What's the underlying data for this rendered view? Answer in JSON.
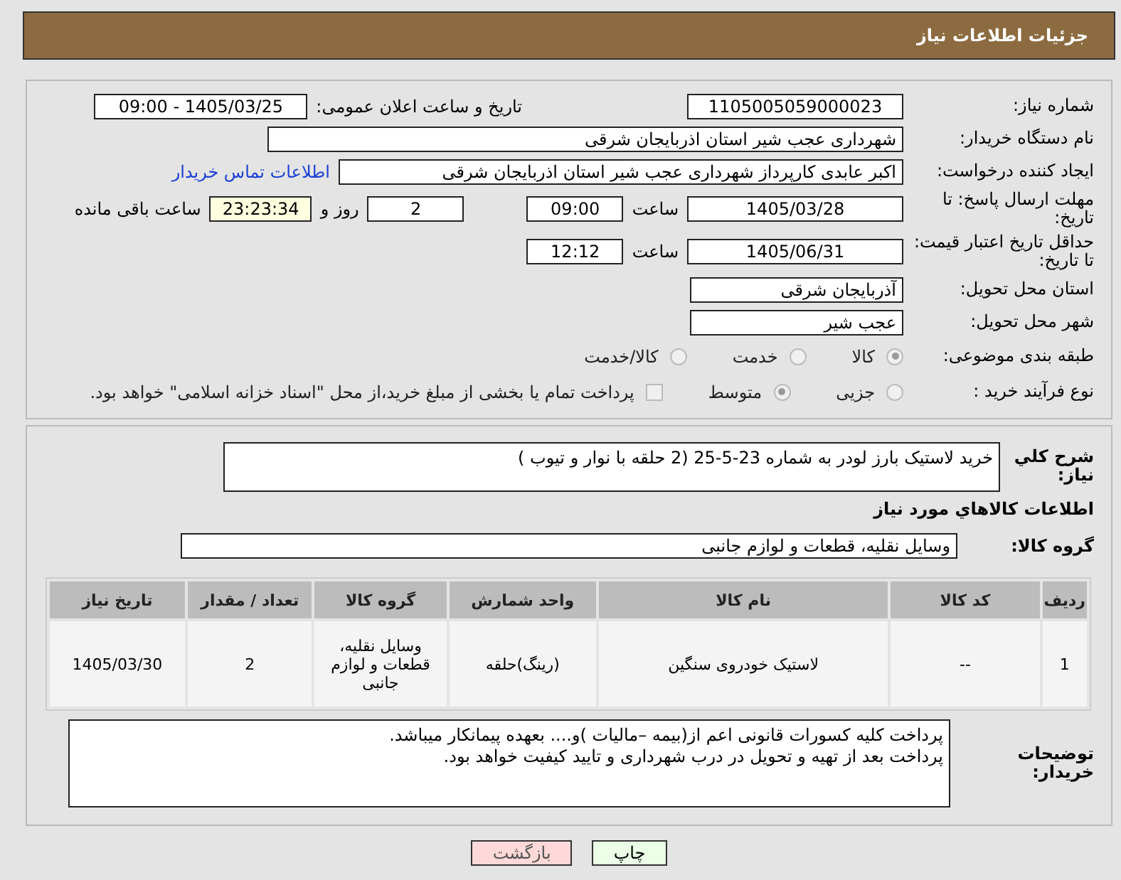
{
  "header": {
    "title": "جزئیات اطلاعات نیاز"
  },
  "need_number": {
    "label": "شماره نیاز:",
    "value": "1105005059000023"
  },
  "announce": {
    "label": "تاریخ و ساعت اعلان عمومی:",
    "value": "1405/03/25 - 09:00"
  },
  "buyer_org": {
    "label": "نام دستگاه خریدار:",
    "value": "شهرداری عجب شیر استان اذربایجان شرقی"
  },
  "requester": {
    "label": "ایجاد کننده درخواست:",
    "value": "اکبر عابدی کارپرداز شهرداری عجب شیر استان اذربایجان شرقی",
    "link": "اطلاعات تماس خریدار"
  },
  "deadline": {
    "label": "مهلت ارسال پاسخ: تا تاریخ:",
    "date": "1405/03/28",
    "time_label": "ساعت",
    "time": "09:00",
    "days": "2",
    "days_label": "روز و",
    "remaining": "23:23:34",
    "remaining_label": "ساعت باقی مانده"
  },
  "validity": {
    "label": "حداقل تاریخ اعتبار قیمت: تا تاریخ:",
    "date": "1405/06/31",
    "time_label": "ساعت",
    "time": "12:12"
  },
  "province": {
    "label": "استان محل تحویل:",
    "value": "آذربایجان شرقی"
  },
  "city": {
    "label": "شهر محل تحویل:",
    "value": "عجب شیر"
  },
  "category": {
    "label": "طبقه بندی موضوعی:",
    "options": [
      {
        "label": "کالا",
        "selected": true
      },
      {
        "label": "خدمت",
        "selected": false
      },
      {
        "label": "کالا/خدمت",
        "selected": false
      }
    ]
  },
  "process": {
    "label": "نوع فرآیند خرید :",
    "options": [
      {
        "label": "جزیی",
        "selected": false
      },
      {
        "label": "متوسط",
        "selected": true
      }
    ],
    "treasury": {
      "label": "پرداخت تمام یا بخشی از مبلغ خرید،از محل \"اسناد خزانه اسلامی\" خواهد بود.",
      "checked": false
    }
  },
  "summary": {
    "label": "شرح کلي نیاز:",
    "value": "خرید لاستیک بارز لودر به شماره 23-5-25 (2 حلقه با نوار و تیوب )"
  },
  "goods_title": "اطلاعات کالاهاي مورد نیاز",
  "goods_group": {
    "label": "گروه کالا:",
    "value": "وسایل نقلیه، قطعات و لوازم جانبی"
  },
  "table": {
    "columns": [
      "ردیف",
      "کد کالا",
      "نام کالا",
      "واحد شمارش",
      "گروه کالا",
      "تعداد / مقدار",
      "تاریخ نیاز"
    ],
    "rows": [
      [
        "1",
        "--",
        "لاستیک خودروی سنگین",
        "(رینگ)حلقه",
        "وسایل نقلیه، قطعات و لوازم جانبی",
        "2",
        "1405/03/30"
      ]
    ]
  },
  "buyer_notes": {
    "label": "توضیحات خریدار:",
    "lines": [
      "پرداخت کلیه کسورات قانونی اعم از(بیمه –مالیات )و.... بعهده پیمانکار میباشد.",
      "پرداخت بعد از تهیه و تحویل در درب شهرداری  و تایید کیفیت خواهد بود."
    ]
  },
  "buttons": [
    {
      "label": "چاپ",
      "kind": "print"
    },
    {
      "label": "بازگشت",
      "kind": "back"
    }
  ]
}
